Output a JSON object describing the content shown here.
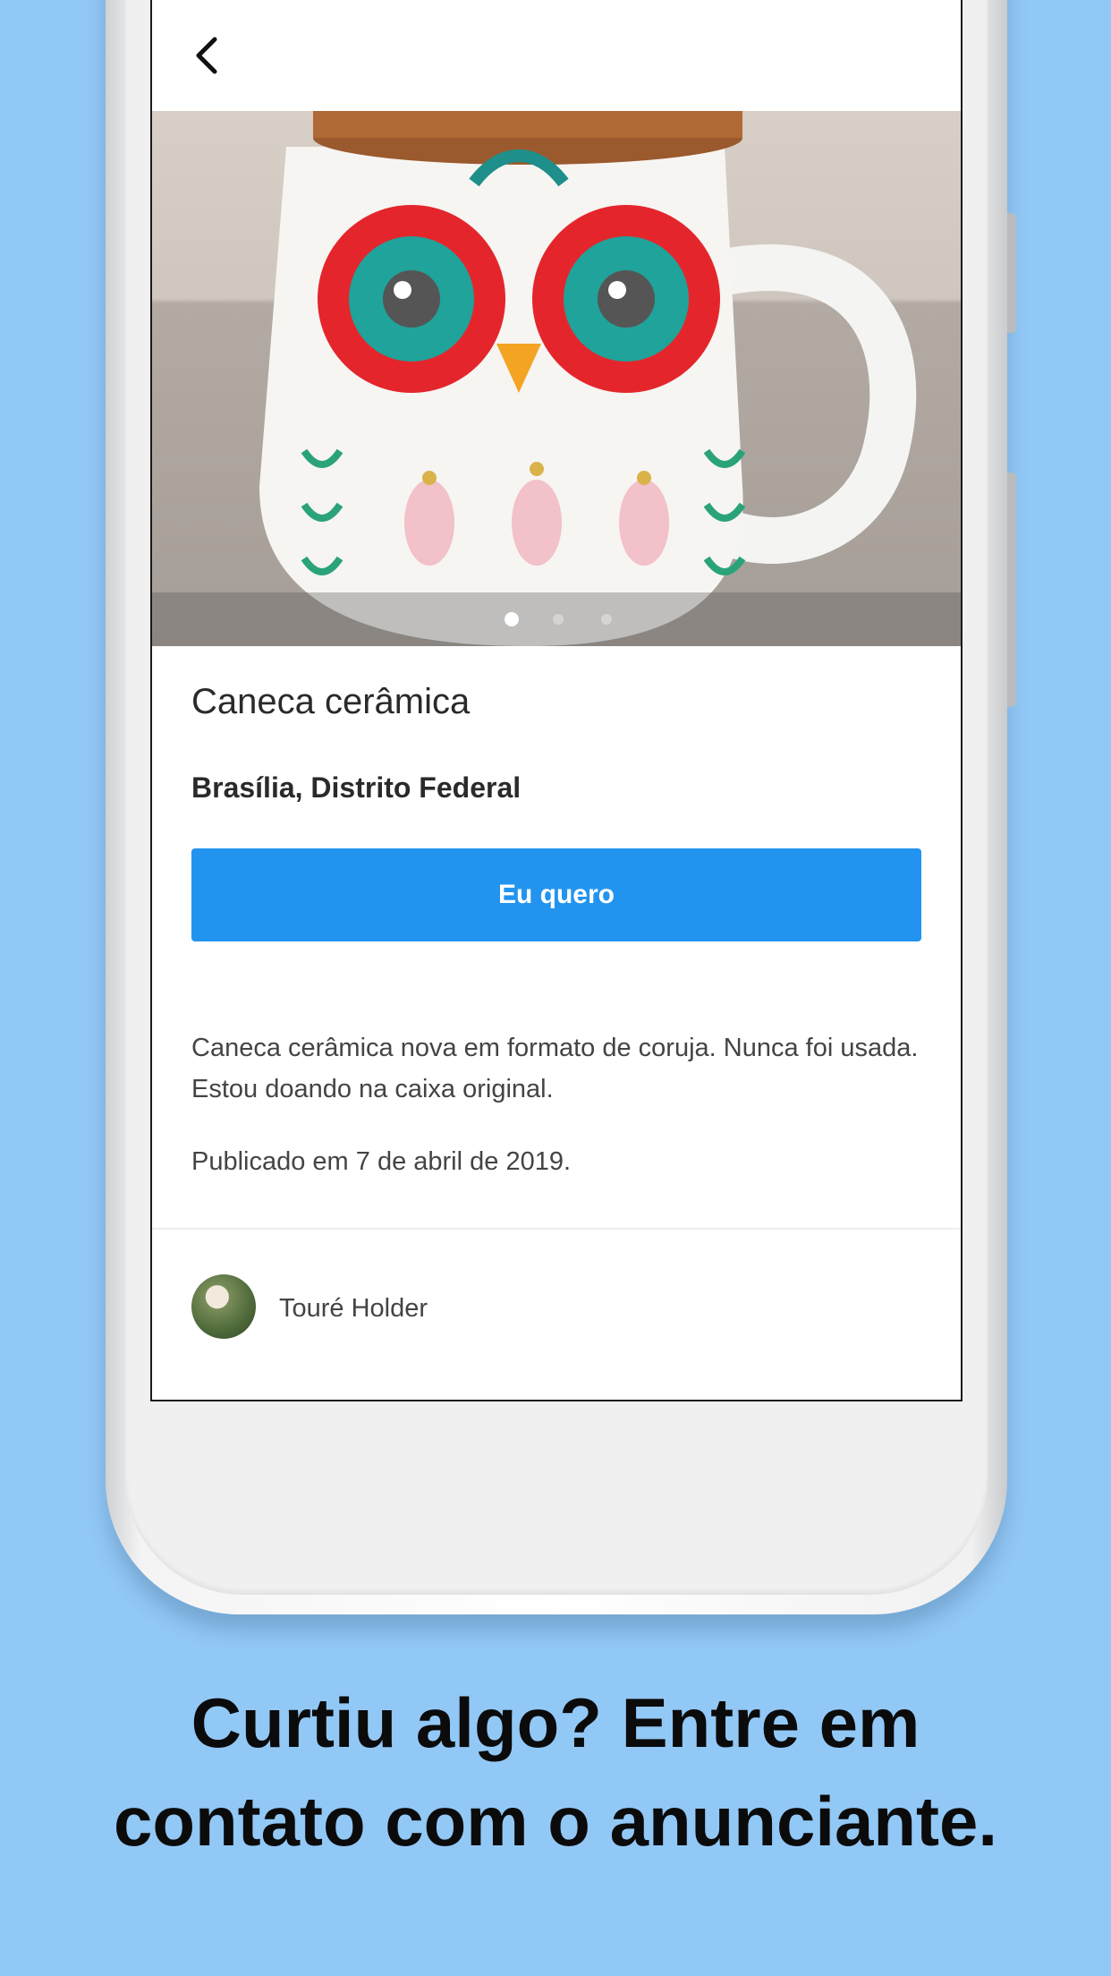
{
  "product": {
    "title": "Caneca cerâmica",
    "location": "Brasília, Distrito Federal",
    "cta_label": "Eu quero",
    "description": "Caneca cerâmica nova em formato de coruja. Nunca foi usada. Estou doando na caixa original.",
    "published": "Publicado em 7 de abril de 2019."
  },
  "gallery": {
    "current_index": 1,
    "total": 3
  },
  "user": {
    "name": "Touré Holder"
  },
  "caption": {
    "line1": "Curtiu algo? Entre em",
    "line2": "contato com o anunciante."
  },
  "colors": {
    "background": "#92c8f6",
    "accent": "#2294f0"
  }
}
